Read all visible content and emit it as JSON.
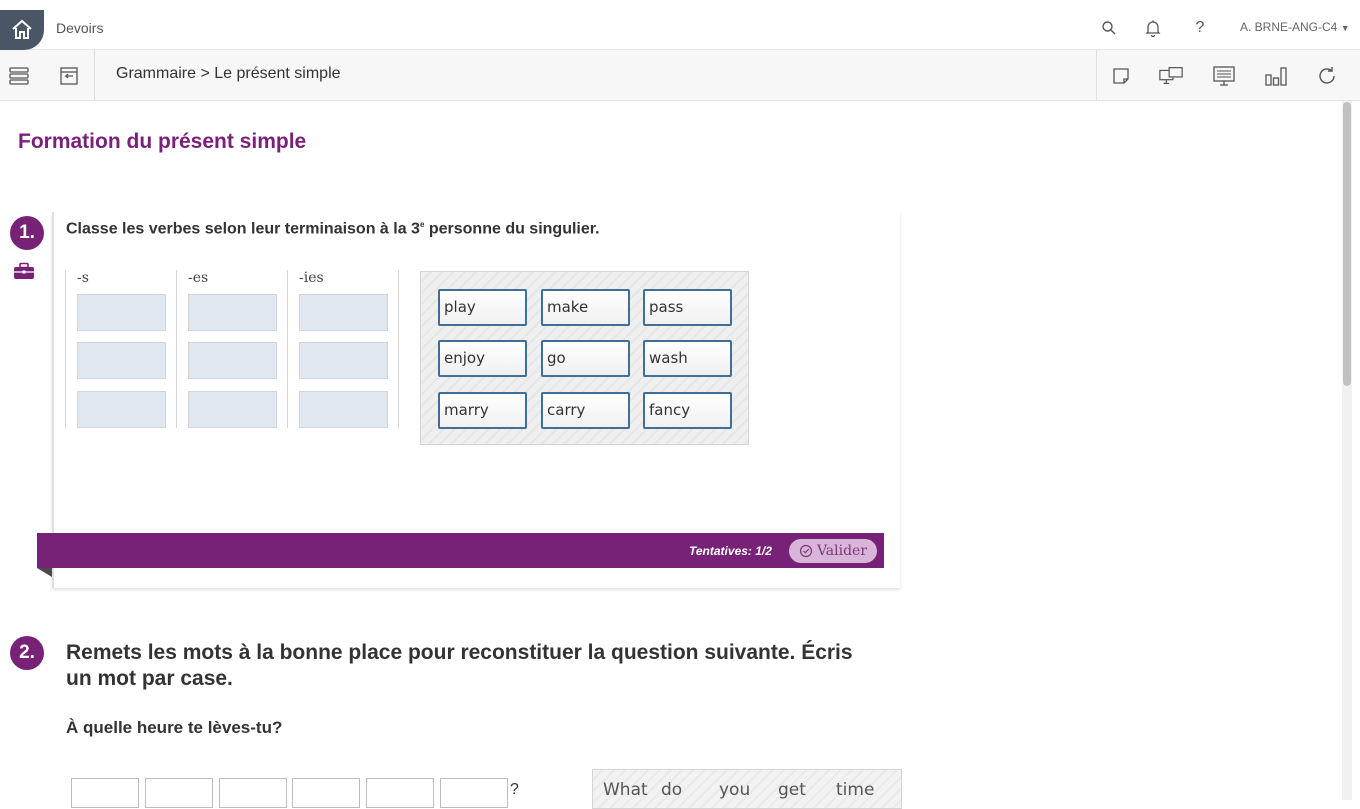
{
  "header": {
    "app_title": "Devoirs",
    "help_label": "?",
    "user": "A. BRNE-ANG-C4"
  },
  "toolbar": {
    "breadcrumb": "Grammaire > Le présent simple"
  },
  "page": {
    "title": "Formation du présent simple"
  },
  "exercise1": {
    "number": "1.",
    "instruction_pre": "Classe les verbes selon leur terminaison à la 3",
    "instruction_sup": "e",
    "instruction_post": " personne du singulier.",
    "columns": [
      "-s",
      "-es",
      "-ies"
    ],
    "word_bank": [
      "play",
      "make",
      "pass",
      "enjoy",
      "go",
      "wash",
      "marry",
      "carry",
      "fancy"
    ],
    "attempts": "Tentatives: 1/2",
    "validate_label": "Valider"
  },
  "exercise2": {
    "number": "2.",
    "instruction": "Remets les mots à la bonne place pour reconstituer la question suivante. Écris un mot par case.",
    "sentence": "À quelle heure te lèves-tu?",
    "question_mark": "?",
    "word_bank": [
      "What",
      "do",
      "you",
      "get",
      "time"
    ]
  }
}
